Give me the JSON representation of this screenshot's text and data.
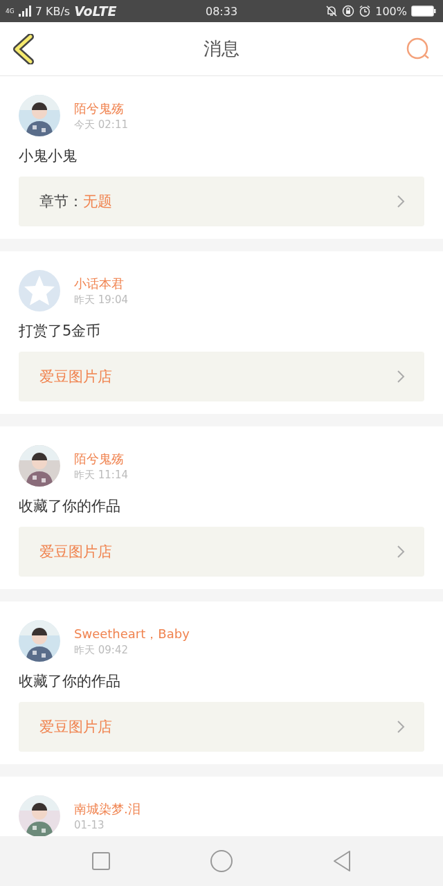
{
  "status_bar": {
    "network": "4G",
    "speed": "7 KB/s",
    "volte": "VoLTE",
    "time": "08:33",
    "battery_text": "100%"
  },
  "header": {
    "title": "消息"
  },
  "messages": [
    {
      "kind": "picture",
      "name": "陌兮鬼殇",
      "time": "今天 02:11",
      "text": "小鬼小鬼",
      "link_label": "章节：",
      "link_title": "无题"
    },
    {
      "kind": "default",
      "name": "小话本君",
      "time": "昨天 19:04",
      "text": "打赏了5金币",
      "link_title": "爱豆图片店"
    },
    {
      "kind": "picture",
      "name": "陌兮鬼殇",
      "time": "昨天 11:14",
      "text": "收藏了你的作品",
      "link_title": "爱豆图片店"
    },
    {
      "kind": "picture",
      "name": "Sweetheart，Baby",
      "time": "昨天 09:42",
      "text": "收藏了你的作品",
      "link_title": "爱豆图片店"
    },
    {
      "kind": "picture",
      "name": "南城染梦.泪",
      "time": "01-13"
    }
  ]
}
